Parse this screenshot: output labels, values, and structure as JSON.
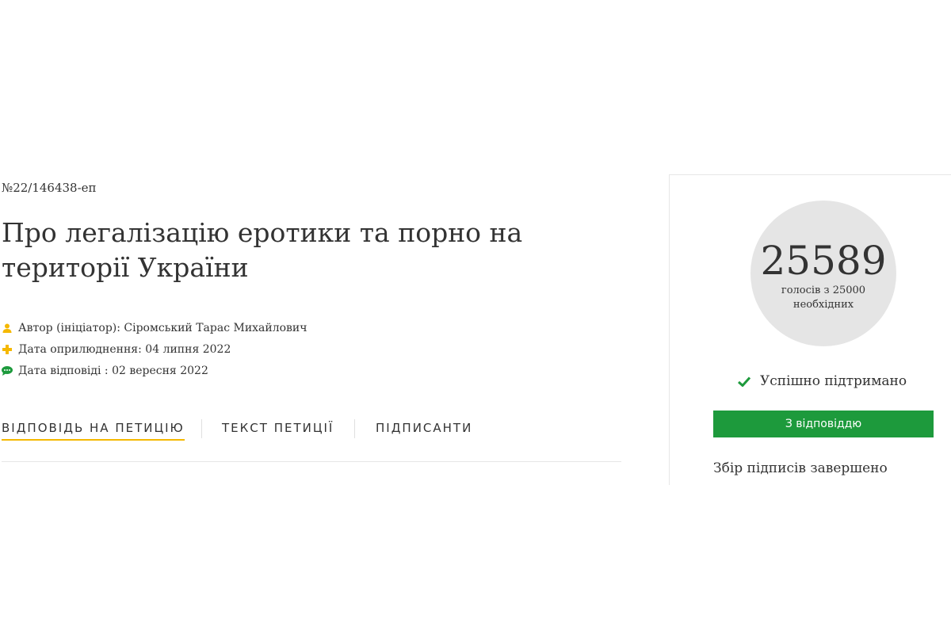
{
  "petition": {
    "number": "№22/146438-еп",
    "title": "Про легалізацію еротики та порно на території України",
    "meta": [
      {
        "icon": "user-icon",
        "text": "Автор (ініціатор): Сіромський Тарас Михайлович"
      },
      {
        "icon": "plus-icon",
        "text": "Дата оприлюднення: 04 липня 2022"
      },
      {
        "icon": "comment-icon",
        "text": "Дата відповіді : 02 вересня 2022"
      }
    ]
  },
  "tabs": [
    {
      "label": "ВІДПОВІДЬ НА ПЕТИЦІЮ",
      "active": true
    },
    {
      "label": "ТЕКСТ ПЕТИЦІЇ",
      "active": false
    },
    {
      "label": "ПІДПИСАНТИ",
      "active": false
    }
  ],
  "votes": {
    "count": "25589",
    "caption_line1": "голосів з 25000",
    "caption_line2": "необхідних"
  },
  "status": {
    "supported_text": "Успішно підтримано",
    "button_label": "З відповіддю",
    "collection_text": "Збір підписів завершено"
  },
  "colors": {
    "accent_yellow": "#f5b800",
    "success_green": "#1d9a3c",
    "circle_gray": "#e5e5e5"
  }
}
